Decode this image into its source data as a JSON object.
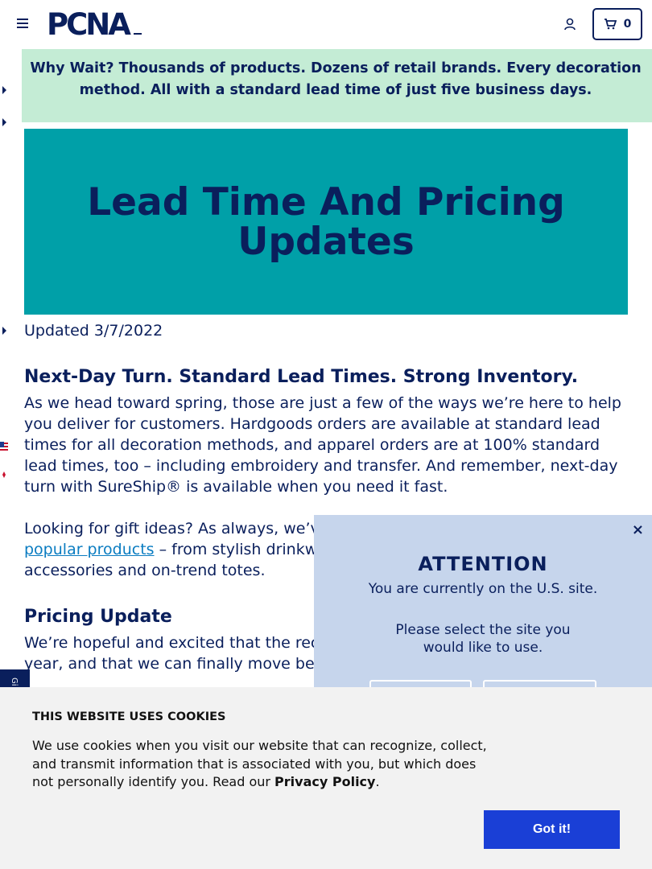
{
  "header": {
    "logo_text": "PCNA",
    "cart_count": "0"
  },
  "banner": {
    "text": "Why Wait? Thousands of products. Dozens of retail brands. Every decoration method. All with a standard lead time of just five business days."
  },
  "hero": {
    "title": "Lead Time And Pricing Updates"
  },
  "article": {
    "updated": "Updated 3/7/2022",
    "heading1": "Next-Day Turn. Standard Lead Times. Strong Inventory.",
    "para1": "As we head toward spring, those are just a few of the ways we’re here to help you deliver for customers. Hardgoods orders are available at standard lead times for all decoration methods, and apparel orders are at 100% standard lead times, too – including embroidery and transfer. And remember, next-day turn with SureShip® is available when you need it fast.",
    "para2_start": "Looking for gift ideas? As always, we’ve",
    "para2_link": "popular products",
    "para2_mid": " – from stylish drinkw",
    "para2_end": "accessories and on-trend totes.",
    "heading2": "Pricing Update",
    "para3_line1": "We’re hopeful and excited that the reco",
    "para3_line2": "year, and that we can finally move beyo"
  },
  "gift_tab": {
    "label": "Gi"
  },
  "attention": {
    "close": "×",
    "title": "ATTENTION",
    "line1": "You are currently on the U.S. site.",
    "line2a": "Please select the site you",
    "line2b": "would like to use."
  },
  "cookie": {
    "title": "THIS WEBSITE USES COOKIES",
    "text": "We use cookies when you visit our website that can recognize, collect, and transmit information that is associated with you, but which does not personally identify you. Read our ",
    "link": "Privacy Policy",
    "end": ".",
    "button": "Got it!"
  },
  "colors": {
    "navy": "#0a1f5c",
    "teal": "#00a0a8",
    "mint": "#c4ecd5",
    "link": "#0a7cc1",
    "button_blue": "#1a3fd6"
  }
}
